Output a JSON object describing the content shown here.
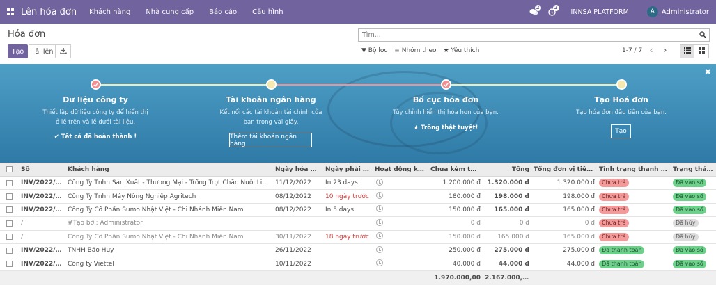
{
  "navbar": {
    "brand": "Lên hóa đơn",
    "menu": [
      "Khách hàng",
      "Nhà cung cấp",
      "Báo cáo",
      "Cấu hình"
    ],
    "chat_badge": "2",
    "activity_badge": "2",
    "company": "INNSA PLATFORM",
    "avatar_letter": "A",
    "user": "Administrator"
  },
  "control": {
    "title": "Hóa đơn",
    "create_label": "Tạo",
    "upload_label": "Tải lên",
    "search_placeholder": "Tìm...",
    "filter_label": "Bộ lọc",
    "groupby_label": "Nhóm theo",
    "favorites_label": "Yêu thích",
    "pager": "1-7 / 7"
  },
  "banner": {
    "steps": [
      {
        "title": "Dữ liệu công ty",
        "desc_lines": [
          "Thiết lập dữ liệu công ty để hiển thị",
          "ở lề trên và lề dưới tài liệu."
        ],
        "done_text": "✔ Tất cả đã hoàn thành !"
      },
      {
        "title": "Tài khoản ngân hàng",
        "desc_lines": [
          "Kết nối các tài khoản tài chính của",
          "bạn trong vài giây."
        ],
        "button": "Thêm tài khoản ngân hàng"
      },
      {
        "title": "Bố cục hóa đơn",
        "desc_lines": [
          "Tùy chỉnh hiển thị hóa hơn của bạn."
        ],
        "done_text": "★ Trông thật tuyệt!"
      },
      {
        "title": "Tạo Hoá đơn",
        "desc_lines": [
          "Tạo hóa đơn đầu tiên của bạn."
        ],
        "button": "Tạo"
      }
    ]
  },
  "table": {
    "headers": [
      "Số",
      "Khách hàng",
      "Ngày hóa đơn",
      "Ngày phải trả...",
      "Hoạt động kế ti...",
      "Chưa kèm thuế...",
      "Tổng",
      "Tổng đơn vị tiền tệ",
      "Tình trạng thanh toán...",
      "Trạng thái..."
    ],
    "rows": [
      {
        "number": "INV/2022/000...",
        "customer": "Công Ty Tnhh Sản Xuất - Thương Mại - Trồng Trọt Chăn Nuôi Linh Hân ...",
        "date": "11/12/2022",
        "due": "In 23 days",
        "due_red": false,
        "untaxed": "1.200.000 đ",
        "total": "1.320.000 đ",
        "currency_total": "1.320.000 đ",
        "payment": "Chưa trả",
        "payment_color": "red",
        "state": "Đã vào sổ",
        "state_color": "green",
        "muted": false
      },
      {
        "number": "INV/2022/000...",
        "customer": "Công Ty Tnhh Máy Nông Nghiệp Agritech",
        "date": "08/12/2022",
        "due": "10 ngày trước",
        "due_red": true,
        "untaxed": "180.000 đ",
        "total": "198.000 đ",
        "currency_total": "198.000 đ",
        "payment": "Chưa trả",
        "payment_color": "red",
        "state": "Đã vào sổ",
        "state_color": "green",
        "muted": false
      },
      {
        "number": "INV/2022/000...",
        "customer": "Công Ty Cổ Phần Sumo Nhật Việt - Chi Nhánh Miền Nam",
        "date": "08/12/2022",
        "due": "In 5 days",
        "due_red": false,
        "untaxed": "150.000 đ",
        "total": "165.000 đ",
        "currency_total": "165.000 đ",
        "payment": "Chưa trả",
        "payment_color": "red",
        "state": "Đã vào sổ",
        "state_color": "green",
        "muted": false
      },
      {
        "number": "/",
        "customer": "#Tạo bởi: Administrator",
        "date": "",
        "due": "",
        "due_red": false,
        "untaxed": "0 đ",
        "total": "0 đ",
        "currency_total": "0 đ",
        "payment": "Chưa trả",
        "payment_color": "red",
        "state": "Đã hủy",
        "state_color": "grey",
        "muted": true
      },
      {
        "number": "/",
        "customer": "Công Ty Cổ Phần Sumo Nhật Việt - Chi Nhánh Miền Nam",
        "date": "30/11/2022",
        "due": "18 ngày trước",
        "due_red": true,
        "untaxed": "150.000 đ",
        "total": "165.000 đ",
        "currency_total": "165.000 đ",
        "payment": "Chưa trả",
        "payment_color": "red",
        "state": "Đã hủy",
        "state_color": "grey",
        "muted": true
      },
      {
        "number": "INV/2022/000...",
        "customer": "TNHH Bảo Huy",
        "date": "26/11/2022",
        "due": "",
        "due_red": false,
        "untaxed": "250.000 đ",
        "total": "275.000 đ",
        "currency_total": "275.000 đ",
        "payment": "Đã thanh toán",
        "payment_color": "green",
        "state": "Đã vào sổ",
        "state_color": "green",
        "muted": false
      },
      {
        "number": "INV/2022/000...",
        "customer": "Công ty Viettel",
        "date": "10/11/2022",
        "due": "",
        "due_red": false,
        "untaxed": "40.000 đ",
        "total": "44.000 đ",
        "currency_total": "44.000 đ",
        "payment": "Đã thanh toán",
        "payment_color": "green",
        "state": "Đã vào sổ",
        "state_color": "green",
        "muted": false
      }
    ],
    "footer": {
      "untaxed": "1.970.000,00",
      "total": "2.167.000,00"
    }
  },
  "colors": {
    "brand": "#71639e",
    "banner": "#3c8ab5",
    "paid": "#6fd08b",
    "unpaid": "#f39a9a"
  }
}
